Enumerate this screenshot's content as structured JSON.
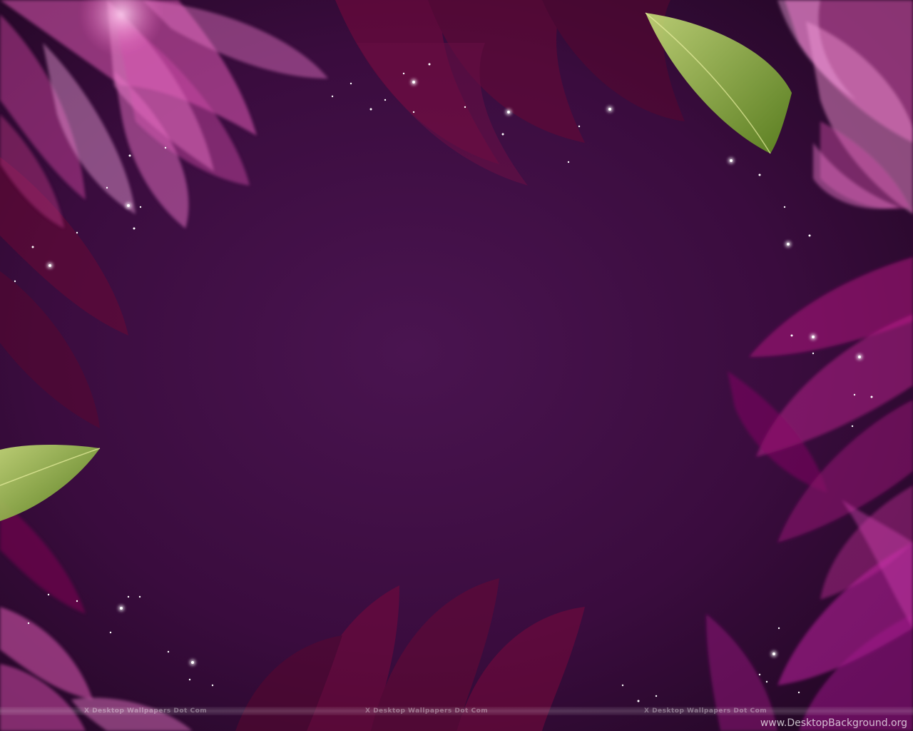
{
  "wallpaper": {
    "colors": {
      "background_center": "#4a1450",
      "background_edge": "#1e0620",
      "petal_pink": "#e05ab4",
      "petal_magenta": "#b0107e",
      "petal_crimson": "#7a0a3c",
      "leaf_green": "#a8c94a",
      "sparkle": "#ffffff"
    },
    "watermarks": [
      "X Desktop Wallpapers Dot Com",
      "X Desktop Wallpapers Dot Com",
      "X Desktop Wallpapers Dot Com"
    ],
    "site_credit": "www.DesktopBackground.org"
  }
}
